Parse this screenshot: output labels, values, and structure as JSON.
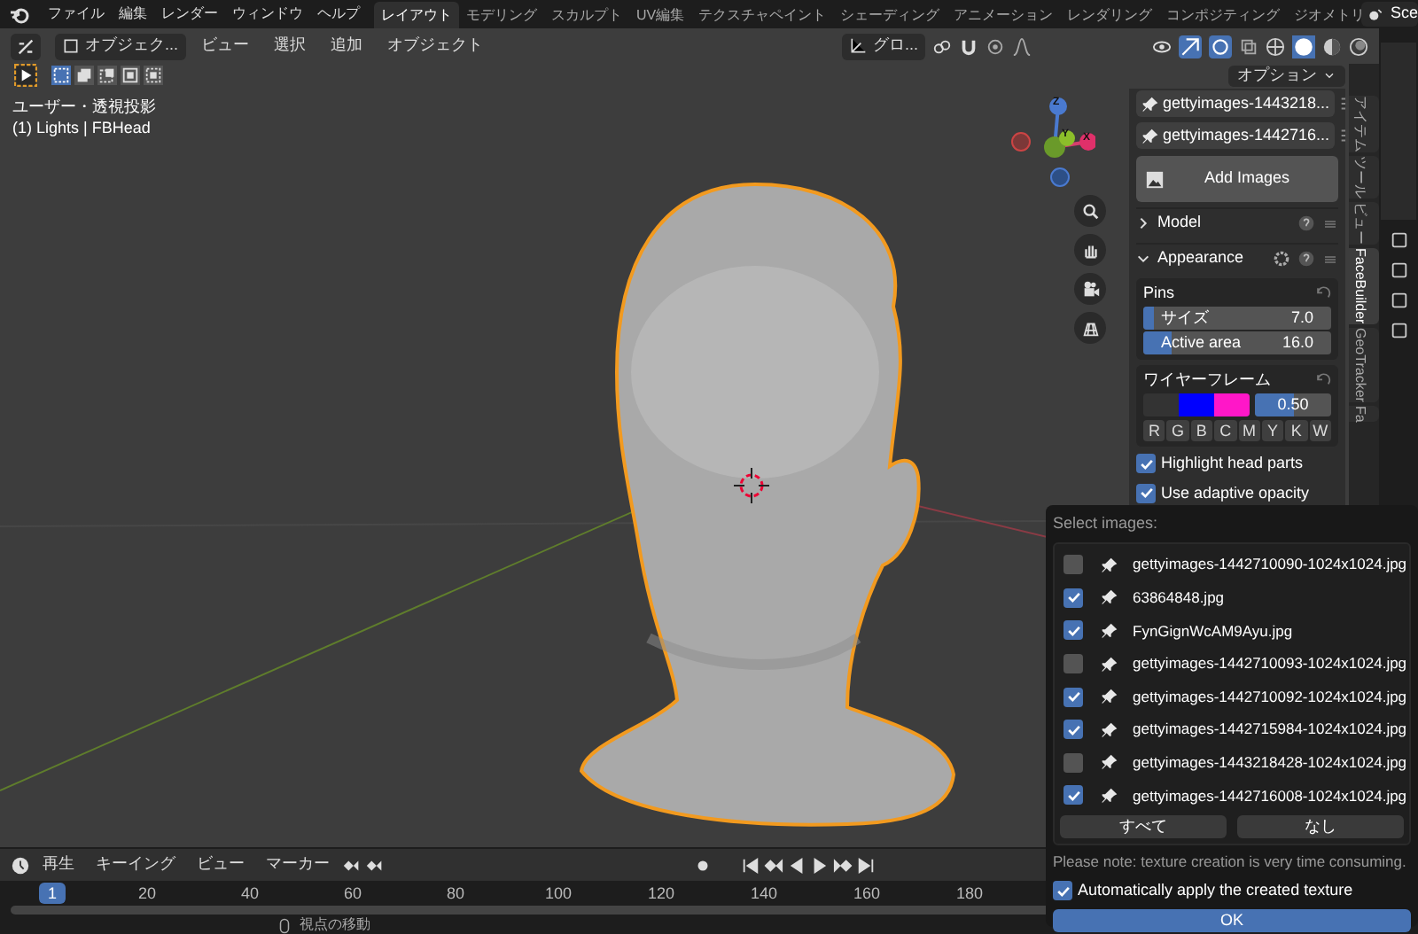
{
  "menu_bar": {
    "menus": [
      "ファイル",
      "編集",
      "レンダー",
      "ウィンドウ",
      "ヘルプ"
    ],
    "workspaces": [
      {
        "label": "レイアウト",
        "selected": true
      },
      {
        "label": "モデリング",
        "selected": false
      },
      {
        "label": "スカルプト",
        "selected": false
      },
      {
        "label": "UV編集",
        "selected": false
      },
      {
        "label": "テクスチャペイント",
        "selected": false
      },
      {
        "label": "シェーディング",
        "selected": false
      },
      {
        "label": "アニメーション",
        "selected": false
      },
      {
        "label": "レンダリング",
        "selected": false
      },
      {
        "label": "コンポジティング",
        "selected": false
      },
      {
        "label": "ジオメトリ",
        "selected": false
      }
    ],
    "scene": "Sce"
  },
  "viewport_header": {
    "mode": "オブジェク...",
    "menus": [
      "ビュー",
      "選択",
      "追加",
      "オブジェクト"
    ],
    "orientation": "グロ...",
    "options": "オプション"
  },
  "viewport": {
    "view_name": "ユーザー・透視投影",
    "object_info": "(1) Lights | FBHead",
    "gizmo_labels": [
      "Z",
      "Y",
      "X"
    ]
  },
  "sidebar": {
    "tabs": [
      {
        "label": "アイテム",
        "selected": false
      },
      {
        "label": "ツール",
        "selected": false
      },
      {
        "label": "ビュー",
        "selected": false
      },
      {
        "label": "FaceBuilder",
        "selected": true
      },
      {
        "label": "GeoTracker",
        "selected": false
      },
      {
        "label": "Fa",
        "selected": false
      }
    ],
    "images": [
      "gettyimages-1443218...",
      "gettyimages-1442716..."
    ],
    "add_images": "Add Images",
    "sections": [
      {
        "label": "Model",
        "expanded": false
      },
      {
        "label": "Appearance",
        "expanded": true
      }
    ],
    "pins": {
      "title": "Pins",
      "fields": [
        {
          "label": "サイズ",
          "value": "7.0",
          "level": 0.06
        },
        {
          "label": "Active area",
          "value": "16.0",
          "level": 0.15
        }
      ]
    },
    "wireframe": {
      "title": "ワイヤーフレーム",
      "swatches": [
        {
          "color": "#0000ff"
        },
        {
          "color": "#ff17c8"
        }
      ],
      "opacity": {
        "value": "0.50",
        "level": 0.5
      },
      "buttons": [
        "R",
        "G",
        "B",
        "C",
        "M",
        "Y",
        "K",
        "W"
      ]
    },
    "checkboxes": [
      {
        "label": "Highlight head parts",
        "checked": true
      },
      {
        "label": "Use adaptive opacity",
        "checked": true
      }
    ]
  },
  "dialog": {
    "title": "Select images:",
    "items": [
      {
        "label": "gettyimages-1442710090-1024x1024.jpg",
        "checked": false
      },
      {
        "label": "63864848.jpg",
        "checked": true
      },
      {
        "label": "FynGignWcAM9Ayu.jpg",
        "checked": true
      },
      {
        "label": "gettyimages-1442710093-1024x1024.jpg",
        "checked": false
      },
      {
        "label": "gettyimages-1442710092-1024x1024.jpg",
        "checked": true
      },
      {
        "label": "gettyimages-1442715984-1024x1024.jpg",
        "checked": true
      },
      {
        "label": "gettyimages-1443218428-1024x1024.jpg",
        "checked": false
      },
      {
        "label": "gettyimages-1442716008-1024x1024.jpg",
        "checked": true
      }
    ],
    "buttons": [
      "すべて",
      "なし"
    ],
    "note": "Please note: texture creation is very time consuming.",
    "auto_apply": {
      "label": "Automatically apply the created texture",
      "checked": true
    },
    "ok": "OK"
  },
  "timeline": {
    "menus": [
      "再生",
      "キーイング",
      "ビュー",
      "マーカー"
    ],
    "current_frame": "1",
    "ticks": [
      "20",
      "40",
      "60",
      "80",
      "100",
      "120",
      "140",
      "160",
      "180"
    ]
  },
  "status_bar": {
    "hint": "視点の移動"
  }
}
